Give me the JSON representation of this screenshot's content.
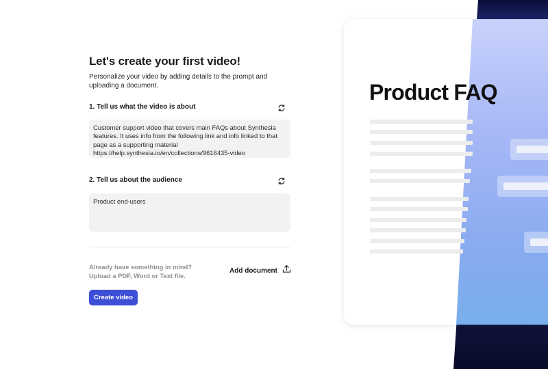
{
  "page": {
    "title": "Let's create your first video!",
    "subtitle": "Personalize your video by adding details to the prompt and uploading a document."
  },
  "section_about": {
    "label": "1. Tell us what the video is about",
    "value": "Customer support video that covers main FAQs about Synthesia features. It uses info from the following link and info linked to that page as a supporting material https://help.synthesia.io/en/collections/9616435-video",
    "icon": "refresh-icon"
  },
  "section_audience": {
    "label": "2. Tell us about the audience",
    "value": "Product end-users",
    "icon": "refresh-icon"
  },
  "upload": {
    "hint": "Already have something in mind?\nUpload a PDF, Word or Text file.",
    "button_label": "Add document",
    "icon": "upload-icon"
  },
  "create_button": {
    "label": "Create video"
  },
  "preview": {
    "heading": "Product FAQ"
  },
  "colors": {
    "accent": "#3d4fd6",
    "field_background": "#f2f2f2",
    "preview_gradient_top": "#cfd9fb",
    "preview_gradient_bottom": "#6fb0e8",
    "preview_dark": "#0c0d3b"
  }
}
